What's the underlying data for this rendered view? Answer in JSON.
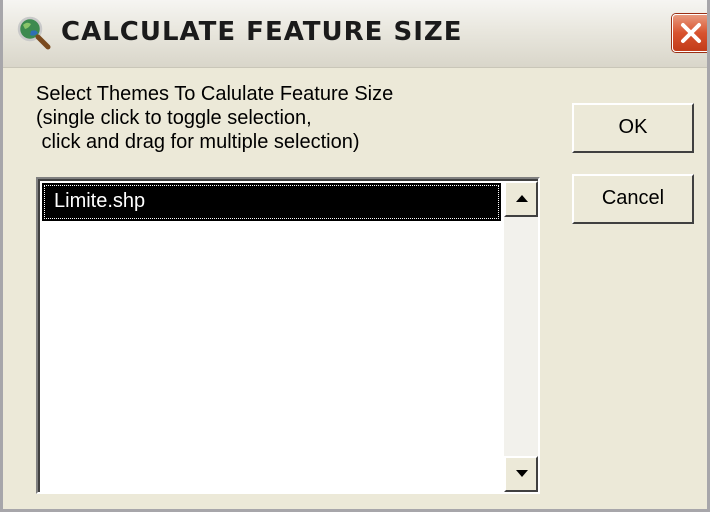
{
  "window": {
    "title": "CALCULATE FEATURE SIZE",
    "icon": "globe-magnifier-icon",
    "close_icon": "close-x-icon"
  },
  "instructions": {
    "line1": "Select Themes To Calulate Feature Size",
    "line2": "(single click to toggle selection,",
    "line3": " click and drag for multiple selection)"
  },
  "themes_list": {
    "items": [
      "Limite.shp"
    ],
    "selected": "Limite.shp"
  },
  "buttons": {
    "ok_label": "OK",
    "cancel_label": "Cancel"
  },
  "colors": {
    "close_button": "#d8532f",
    "selection_background": "#000000",
    "dialog_background": "#ece9d8"
  }
}
